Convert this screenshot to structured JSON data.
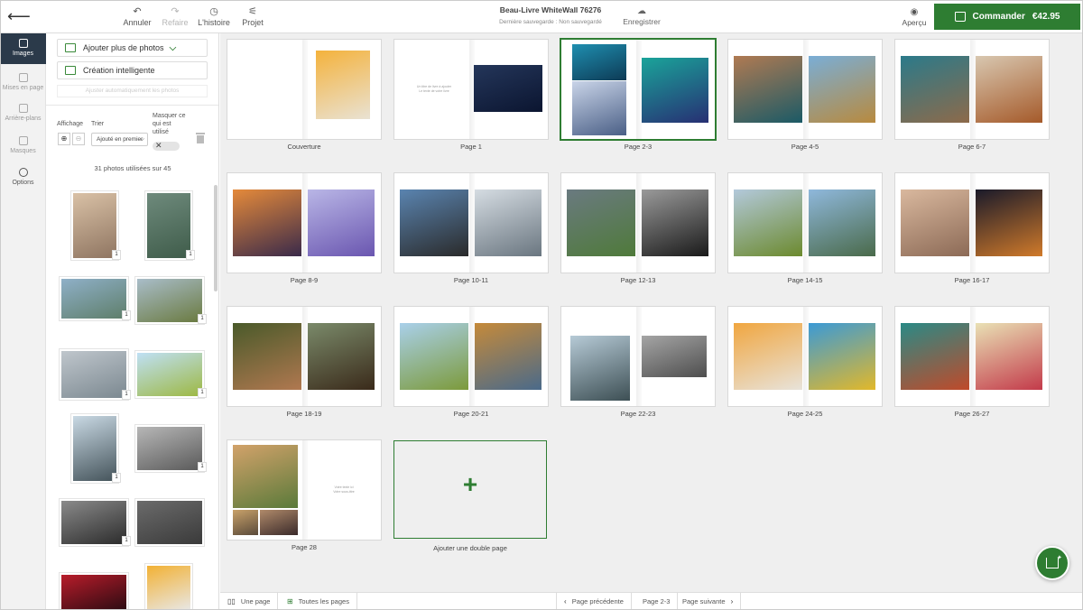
{
  "colors": {
    "brand_green": "#2e7d32",
    "rail_active": "#2b3a4a",
    "canvas_bg": "#efefef"
  },
  "topbar": {
    "undo_label": "Annuler",
    "undo_icon": "undo-arrow",
    "redo_label": "Refaire",
    "redo_icon": "redo-arrow",
    "history_label": "L'histoire",
    "history_icon": "clock",
    "project_label": "Projet",
    "project_icon": "sliders",
    "doc_title": "Beau-Livre WhiteWall 76276",
    "doc_status": "Dernière sauvegarde : Non sauvegardé",
    "save_label": "Enregistrer",
    "save_icon": "cloud",
    "preview_label": "Aperçu",
    "preview_icon": "eye",
    "order_label": "Commander",
    "order_price": "€42.95",
    "order_icon": "shopping-bag"
  },
  "rail": {
    "items": [
      {
        "label": "Images",
        "icon": "images",
        "active": true
      },
      {
        "label": "Mises en page",
        "icon": "layout-grid"
      },
      {
        "label": "Arrière-plans",
        "icon": "background-pattern"
      },
      {
        "label": "Masques",
        "icon": "mask"
      },
      {
        "label": "Options",
        "icon": "gear"
      }
    ]
  },
  "panel": {
    "add_photos_label": "Ajouter plus de photos",
    "smart_label": "Création intelligente",
    "ghost_text": "Ajuster automatiquement les photos",
    "display_label": "Affichage",
    "sort_label": "Trier",
    "sort_value": "Ajouté en premier",
    "hide_used_label_1": "Masquer ce",
    "hide_used_label_2": "qui est",
    "hide_used_label_3": "utilisé",
    "used_count": "31 photos utilisées sur 45",
    "thumbs": [
      {
        "desc": "sunlit-cloud-portrait",
        "colors": [
          "#d9c1a6",
          "#8f7561"
        ],
        "count": "1"
      },
      {
        "desc": "mountain-valley-portrait",
        "colors": [
          "#6e8a7c",
          "#3f5c4a"
        ],
        "count": "1"
      },
      {
        "desc": "dolomite-peak",
        "colors": [
          "#8fb0c8",
          "#5e7e6a"
        ],
        "count": "1"
      },
      {
        "desc": "green-hills-clouds",
        "colors": [
          "#a9bdc9",
          "#6a7a40"
        ],
        "count": "1"
      },
      {
        "desc": "rocky-range",
        "colors": [
          "#bfc6cc",
          "#7b8890"
        ],
        "count": "1"
      },
      {
        "desc": "meadow-hut",
        "colors": [
          "#bfe0f5",
          "#9db842"
        ],
        "count": "1"
      },
      {
        "desc": "blue-cliffs",
        "colors": [
          "#c9d9e4",
          "#45545b"
        ],
        "count": "1"
      },
      {
        "desc": "cracked-bw",
        "colors": [
          "#b7b7b7",
          "#5a5a5a"
        ],
        "count": "1"
      },
      {
        "desc": "curved-road-bw",
        "colors": [
          "#8a8a8a",
          "#2c2c2c"
        ],
        "count": "1"
      },
      {
        "desc": "rock-texture-bw",
        "colors": [
          "#6b6b6b",
          "#3a3a3a"
        ],
        "count": ""
      },
      {
        "desc": "red-lasers",
        "colors": [
          "#b81c2a",
          "#2a0b12"
        ],
        "count": ""
      },
      {
        "desc": "orange-drink",
        "colors": [
          "#f2b134",
          "#e8e8e8"
        ],
        "count": ""
      }
    ]
  },
  "spreads": [
    {
      "label": "Couverture",
      "type": "cover",
      "right": {
        "colors": [
          "#f4b23c",
          "#e9e2d3"
        ]
      }
    },
    {
      "label": "Page 1",
      "type": "textleft",
      "text_lines": [
        "Un titre de livre à ajouter",
        "Le texte de votre livre"
      ],
      "right": {
        "colors": [
          "#24365a",
          "#0b1530"
        ]
      }
    },
    {
      "label": "Page 2-3",
      "type": "double",
      "selected": true,
      "left_top": {
        "colors": [
          "#1f8fb0",
          "#0d3a55"
        ]
      },
      "left_bottom": {
        "colors": [
          "#c9d4e8",
          "#4a5f86"
        ]
      },
      "right": {
        "colors": [
          "#1aa49a",
          "#272f73"
        ]
      }
    },
    {
      "label": "Page 4-5",
      "type": "both",
      "left": {
        "colors": [
          "#b07a52",
          "#1b5a66"
        ]
      },
      "right": {
        "colors": [
          "#7aaed6",
          "#b88a3e"
        ]
      }
    },
    {
      "label": "Page 6-7",
      "type": "both",
      "left": {
        "colors": [
          "#2b7a8a",
          "#8d6a4a"
        ]
      },
      "right": {
        "colors": [
          "#d8c7b0",
          "#a55a2a"
        ]
      }
    },
    {
      "label": "Page 8-9",
      "type": "both",
      "left": {
        "colors": [
          "#e58a3a",
          "#3a2a4a"
        ]
      },
      "right": {
        "colors": [
          "#b9b6e6",
          "#6a56b0"
        ]
      }
    },
    {
      "label": "Page 10-11",
      "type": "both",
      "left": {
        "colors": [
          "#5a84b0",
          "#2a2a2a"
        ]
      },
      "right": {
        "colors": [
          "#d5dce2",
          "#6a7680"
        ]
      }
    },
    {
      "label": "Page 12-13",
      "type": "both",
      "left": {
        "colors": [
          "#6a7a80",
          "#4f7a3a"
        ]
      },
      "right": {
        "colors": [
          "#9a9a9a",
          "#1a1a1a"
        ]
      }
    },
    {
      "label": "Page 14-15",
      "type": "both",
      "left": {
        "colors": [
          "#b3c9db",
          "#6c8a2e"
        ]
      },
      "right": {
        "colors": [
          "#8fb8dc",
          "#4a6a4a"
        ]
      }
    },
    {
      "label": "Page 16-17",
      "type": "both",
      "left": {
        "colors": [
          "#d9b89e",
          "#8c6a56"
        ]
      },
      "right": {
        "colors": [
          "#1a1a2a",
          "#d07a2a"
        ]
      }
    },
    {
      "label": "Page 18-19",
      "type": "both",
      "left": {
        "colors": [
          "#4a5a2a",
          "#b07850"
        ]
      },
      "right": {
        "colors": [
          "#7a8a6a",
          "#3a2a1a"
        ]
      }
    },
    {
      "label": "Page 20-21",
      "type": "both",
      "left": {
        "colors": [
          "#a9d0ea",
          "#7c9a3a"
        ]
      },
      "right": {
        "colors": [
          "#c58a3a",
          "#4a6a8a"
        ]
      }
    },
    {
      "label": "Page 22-23",
      "type": "mixed",
      "left": {
        "colors": [
          "#b6cad6",
          "#3d4f54"
        ]
      },
      "right": {
        "colors": [
          "#a5a5a5",
          "#4e4e4e"
        ]
      }
    },
    {
      "label": "Page 24-25",
      "type": "both",
      "left": {
        "colors": [
          "#f0a640",
          "#e8e3da"
        ]
      },
      "right": {
        "colors": [
          "#3b9ad6",
          "#e2b82a"
        ]
      }
    },
    {
      "label": "Page 26-27",
      "type": "both",
      "left": {
        "colors": [
          "#2a8a86",
          "#c04a2a"
        ]
      },
      "right": {
        "colors": [
          "#e9e1b5",
          "#c33a4a"
        ]
      }
    },
    {
      "label": "Page 28",
      "type": "collage",
      "collage_top": {
        "colors": [
          "#d2a26a",
          "#5a7a3a"
        ]
      },
      "collage_bl": {
        "colors": [
          "#c9a26a",
          "#5a4a3a"
        ]
      },
      "collage_br": {
        "colors": [
          "#b08a6a",
          "#3a2a2a"
        ]
      },
      "text_lines": [
        "Votre texte ici",
        "Votre sous-titre"
      ]
    }
  ],
  "add_spread_label": "Ajouter une double page",
  "bottombar": {
    "single_page_label": "Une page",
    "all_pages_label": "Toutes les pages",
    "prev_label": "Page précédente",
    "current_label": "Page 2-3",
    "next_label": "Page suivante"
  },
  "fab_icon": "magic-book"
}
